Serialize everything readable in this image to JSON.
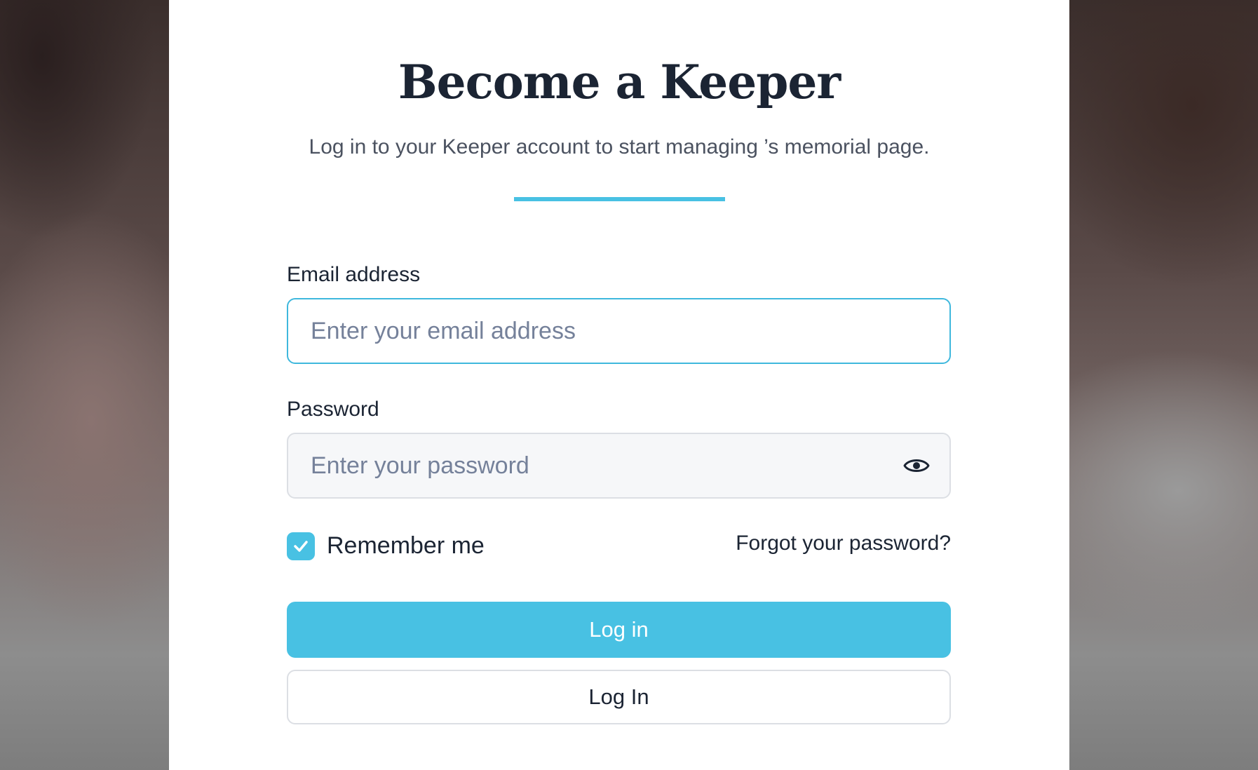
{
  "page": {
    "title": "Become a Keeper",
    "subtitle": "Log in to your Keeper account to start managing ’s memorial page."
  },
  "form": {
    "email": {
      "label": "Email address",
      "placeholder": "Enter your email address",
      "value": ""
    },
    "password": {
      "label": "Password",
      "placeholder": "Enter your password",
      "value": "",
      "toggle_icon": "eye-icon"
    },
    "remember": {
      "label": "Remember me",
      "checked": true
    },
    "forgot_link": "Forgot your password?",
    "primary_button": "Log in",
    "secondary_button": "Log In"
  },
  "colors": {
    "accent": "#48c1e3",
    "text_dark": "#1b2433",
    "text_muted": "#4b5260",
    "placeholder": "#75819a"
  }
}
